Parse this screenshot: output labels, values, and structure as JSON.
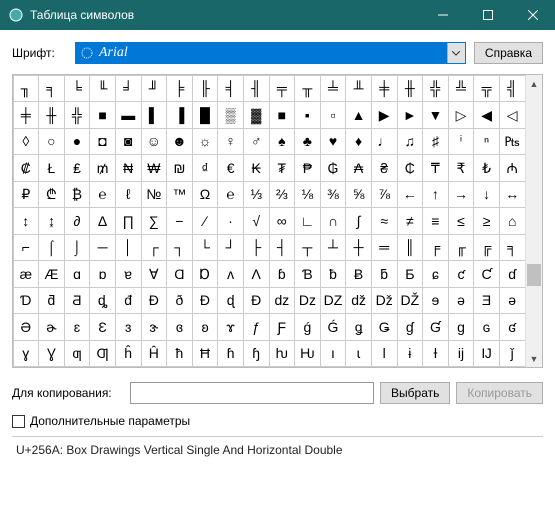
{
  "window": {
    "title": "Таблица символов"
  },
  "font": {
    "label": "Шрифт:",
    "selected": "Arial"
  },
  "help": {
    "label": "Справка"
  },
  "grid": {
    "rows": [
      [
        "╖",
        "╕",
        "╘",
        "╙",
        "╛",
        "╜",
        "╞",
        "╟",
        "╡",
        "╢",
        "╤",
        "╥",
        "╧",
        "╨",
        "╪",
        "╫",
        "╬",
        "╩",
        "╦",
        "╣"
      ],
      [
        "╪",
        "╫",
        "╬",
        "■",
        "▬",
        "▌",
        "▐",
        "█",
        "▒",
        "▓",
        "■",
        "▪",
        "▫",
        "▲",
        "▶",
        "►",
        "▼",
        "▷",
        "◀",
        "◁"
      ],
      [
        "◊",
        "○",
        "●",
        "◘",
        "◙",
        "☺",
        "☻",
        "☼",
        "♀",
        "♂",
        "♠",
        "♣",
        "♥",
        "♦",
        "♩",
        "♫",
        "♯",
        "ⁱ",
        "ⁿ",
        "₧"
      ],
      [
        "₡",
        "Ł",
        "₤",
        "₥",
        "₦",
        "₩",
        "₪",
        "₫",
        "€",
        "₭",
        "₮",
        "₱",
        "₲",
        "₳",
        "₴",
        "₵",
        "₸",
        "₹",
        "₺",
        "₼"
      ],
      [
        "₽",
        "₾",
        "₿",
        "℮",
        "ℓ",
        "№",
        "™",
        "Ω",
        "℮",
        "⅓",
        "⅔",
        "⅛",
        "⅜",
        "⅝",
        "⅞",
        "←",
        "↑",
        "→",
        "↓",
        "↔"
      ],
      [
        "↕",
        "↨",
        "∂",
        "∆",
        "∏",
        "∑",
        "−",
        "∕",
        "∙",
        "√",
        "∞",
        "∟",
        "∩",
        "∫",
        "≈",
        "≠",
        "≡",
        "≤",
        "≥",
        "⌂"
      ],
      [
        "⌐",
        "⌠",
        "⌡",
        "─",
        "│",
        "┌",
        "┐",
        "└",
        "┘",
        "├",
        "┤",
        "┬",
        "┴",
        "┼",
        "═",
        "║",
        "╒",
        "╓",
        "╔",
        "╕"
      ],
      [
        "æ",
        "Æ",
        "ɑ",
        "ɒ",
        "ɐ",
        "Ɐ",
        "Ɑ",
        "Ɒ",
        "ʌ",
        "Ʌ",
        "ɓ",
        "Ɓ",
        "ƀ",
        "Ƀ",
        "ƃ",
        "Ƃ",
        "ɕ",
        "ƈ",
        "Ƈ",
        "ɗ"
      ],
      [
        "Ɗ",
        "ƌ",
        "Ƌ",
        "ȡ",
        "đ",
        "Đ",
        "ð",
        "Ð",
        "ɖ",
        "Ɖ",
        "ǳ",
        "ǲ",
        "Ǳ",
        "ǆ",
        "ǅ",
        "Ǆ",
        "ɘ",
        "ǝ",
        "Ǝ",
        "ə"
      ],
      [
        "Ə",
        "ɚ",
        "ɛ",
        "Ɛ",
        "ɜ",
        "ɝ",
        "ɞ",
        "ʚ",
        "ɤ",
        "ƒ",
        "Ƒ",
        "ǵ",
        "Ǵ",
        "ǥ",
        "Ǥ",
        "ɠ",
        "Ɠ",
        "ɡ",
        "ɢ",
        "ʛ"
      ],
      [
        "ɣ",
        "Ɣ",
        "ƣ",
        "Ƣ",
        "ĥ",
        "Ĥ",
        "ħ",
        "Ħ",
        "ɦ",
        "ɧ",
        "ƕ",
        "Ƕ",
        "ı",
        "ɩ",
        "Ɩ",
        "ɨ",
        "Ɨ",
        "ĳ",
        "Ĳ",
        "ǰ"
      ]
    ]
  },
  "copy": {
    "label": "Для копирования:",
    "value": ""
  },
  "buttons": {
    "select": "Выбрать",
    "copy": "Копировать"
  },
  "advanced": {
    "label": "Дополнительные параметры"
  },
  "status": {
    "text": "U+256A: Box Drawings Vertical Single And Horizontal Double"
  }
}
